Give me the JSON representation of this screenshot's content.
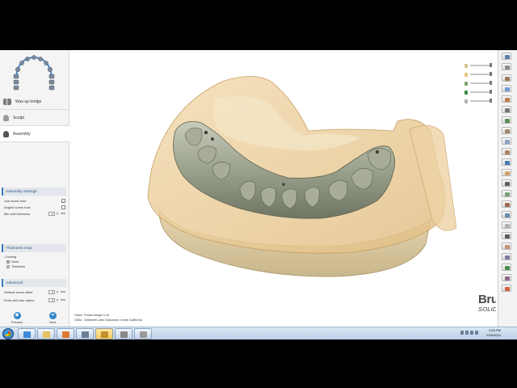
{
  "workflow": {
    "steps": [
      {
        "label": "Wax-up bridge",
        "icon": "wax-up-icon",
        "active": false
      },
      {
        "label": "Sculpt",
        "icon": "sculpt-icon",
        "active": false
      },
      {
        "label": "Assembly",
        "icon": "assembly-icon",
        "active": true
      }
    ]
  },
  "assembly_settings": {
    "title": "Assembly settings",
    "use_screw_hole": {
      "label": "Use screw hole",
      "checked": true
    },
    "angled_screw_hole": {
      "label": "Angled screw hole",
      "checked": false
    },
    "min_wall_thickness": {
      "label": "Min wall thickness",
      "value": "0",
      "unit": "mm"
    }
  },
  "thickness_map": {
    "title": "Thickness map",
    "coloring_label": "Coloring",
    "options": [
      {
        "label": "None",
        "selected": true
      },
      {
        "label": "Thickness",
        "selected": false
      }
    ]
  },
  "advanced": {
    "title": "Advanced",
    "vertical_screw_offset": {
      "label": "Vertical screw offset",
      "value": "0",
      "unit": "mm"
    },
    "extra_drill_hole_radius": {
      "label": "Extra drill hole radius",
      "value": "0",
      "unit": "mm"
    }
  },
  "nav": {
    "preview": "Preview",
    "next": "Next"
  },
  "order_info": {
    "order_key": "Order:",
    "order_value": "Frame bridge 2-14",
    "clinic_key": "Clinic:",
    "clinic_value": "Glidewell Labs Outsource, Irvine California"
  },
  "brand": {
    "name": "BruxZir",
    "mark": "®",
    "tagline": "SOLID ZIRCONIA"
  },
  "taskbar": {
    "time": "3:45 PM",
    "date": "9/30/2014"
  },
  "colors": {
    "accent": "#3a7dc0",
    "gingiva": "#e9c99a",
    "model_tan": "#efe2c4",
    "bridge": "#9aa18c"
  }
}
